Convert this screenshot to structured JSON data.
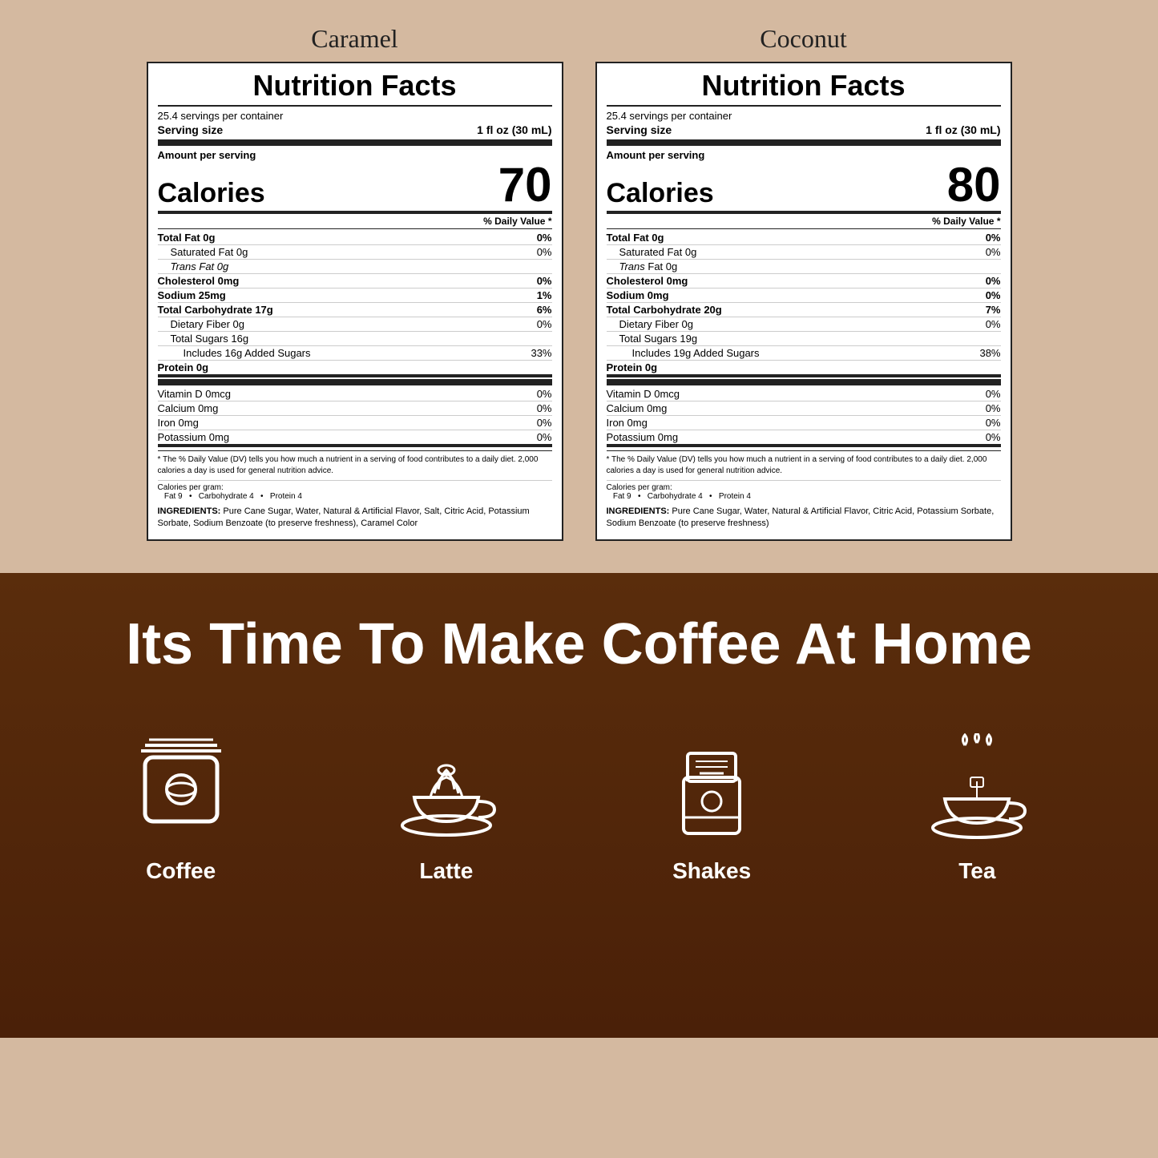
{
  "caramel": {
    "title": "Caramel",
    "nutrition_title": "Nutrition Facts",
    "servings_per_container": "25.4 servings per container",
    "serving_size_label": "Serving size",
    "serving_size_value": "1 fl oz (30 mL)",
    "amount_per_serving": "Amount per serving",
    "calories_label": "Calories",
    "calories_value": "70",
    "daily_value_header": "% Daily Value *",
    "nutrients": [
      {
        "name": "Total Fat 0g",
        "value": "0%",
        "bold": true,
        "indent": 0
      },
      {
        "name": "Saturated Fat 0g",
        "value": "0%",
        "bold": false,
        "indent": 1
      },
      {
        "name": "Trans Fat 0g",
        "value": "",
        "bold": false,
        "indent": 1,
        "italic": true
      },
      {
        "name": "Cholesterol 0mg",
        "value": "0%",
        "bold": true,
        "indent": 0
      },
      {
        "name": "Sodium 25mg",
        "value": "1%",
        "bold": true,
        "indent": 0
      },
      {
        "name": "Total Carbohydrate 17g",
        "value": "6%",
        "bold": true,
        "indent": 0
      },
      {
        "name": "Dietary Fiber 0g",
        "value": "0%",
        "bold": false,
        "indent": 1
      },
      {
        "name": "Total Sugars 16g",
        "value": "",
        "bold": false,
        "indent": 1
      },
      {
        "name": "Includes 16g Added Sugars",
        "value": "33%",
        "bold": false,
        "indent": 2
      },
      {
        "name": "Protein 0g",
        "value": "",
        "bold": true,
        "indent": 0
      }
    ],
    "vitamins": [
      {
        "name": "Vitamin D 0mcg",
        "value": "0%"
      },
      {
        "name": "Calcium 0mg",
        "value": "0%"
      },
      {
        "name": "Iron 0mg",
        "value": "0%"
      },
      {
        "name": "Potassium 0mg",
        "value": "0%"
      }
    ],
    "footnote": "* The % Daily Value (DV) tells you how much a nutrient in a serving of food contributes to a daily diet. 2,000 calories a day is used for general nutrition advice.",
    "calories_per_gram": "Calories per gram:\n   Fat 9   •   Carbohydrate 4   •   Protein 4",
    "ingredients": "INGREDIENTS: Pure Cane Sugar, Water, Natural & Artificial Flavor, Salt, Citric Acid, Potassium Sorbate, Sodium Benzoate (to preserve freshness), Caramel Color"
  },
  "coconut": {
    "title": "Coconut",
    "nutrition_title": "Nutrition Facts",
    "servings_per_container": "25.4 servings per container",
    "serving_size_label": "Serving size",
    "serving_size_value": "1 fl oz (30 mL)",
    "amount_per_serving": "Amount per serving",
    "calories_label": "Calories",
    "calories_value": "80",
    "daily_value_header": "% Daily Value *",
    "nutrients": [
      {
        "name": "Total Fat 0g",
        "value": "0%",
        "bold": true,
        "indent": 0
      },
      {
        "name": "Saturated Fat 0g",
        "value": "0%",
        "bold": false,
        "indent": 1
      },
      {
        "name": "Trans Fat 0g",
        "value": "",
        "bold": false,
        "indent": 1,
        "italic": true
      },
      {
        "name": "Cholesterol 0mg",
        "value": "0%",
        "bold": true,
        "indent": 0
      },
      {
        "name": "Sodium 0mg",
        "value": "0%",
        "bold": true,
        "indent": 0
      },
      {
        "name": "Total Carbohydrate 20g",
        "value": "7%",
        "bold": true,
        "indent": 0
      },
      {
        "name": "Dietary Fiber 0g",
        "value": "0%",
        "bold": false,
        "indent": 1
      },
      {
        "name": "Total Sugars 19g",
        "value": "",
        "bold": false,
        "indent": 1
      },
      {
        "name": "Includes 19g Added Sugars",
        "value": "38%",
        "bold": false,
        "indent": 2
      },
      {
        "name": "Protein 0g",
        "value": "",
        "bold": true,
        "indent": 0
      }
    ],
    "vitamins": [
      {
        "name": "Vitamin D 0mcg",
        "value": "0%"
      },
      {
        "name": "Calcium 0mg",
        "value": "0%"
      },
      {
        "name": "Iron 0mg",
        "value": "0%"
      },
      {
        "name": "Potassium 0mg",
        "value": "0%"
      }
    ],
    "footnote": "* The % Daily Value (DV) tells you how much a nutrient in a serving of food contributes to a daily diet. 2,000 calories a day is used for general nutrition advice.",
    "calories_per_gram": "Calories per gram:\n   Fat 9   •   Carbohydrate 4   •   Protein 4",
    "ingredients": "INGREDIENTS: Pure Cane Sugar, Water, Natural & Artificial Flavor, Citric Acid, Potassium Sorbate, Sodium Benzoate (to preserve freshness)"
  },
  "bottom": {
    "tagline": "Its Time To Make Coffee At Home",
    "icons": [
      {
        "name": "coffee",
        "label": "Coffee"
      },
      {
        "name": "latte",
        "label": "Latte"
      },
      {
        "name": "shakes",
        "label": "Shakes"
      },
      {
        "name": "tea",
        "label": "Tea"
      }
    ]
  }
}
